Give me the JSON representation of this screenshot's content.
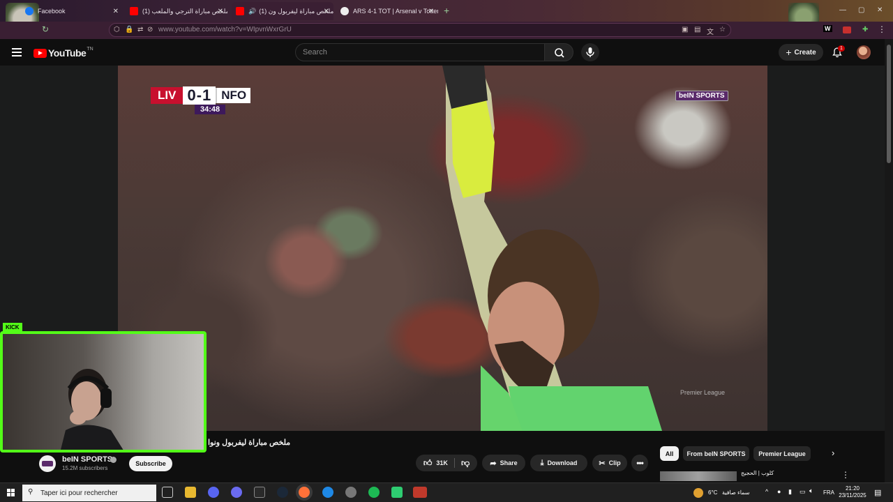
{
  "browser": {
    "tabs": [
      {
        "label": "Facebook",
        "active": false,
        "favicon_color": "#1877f2"
      },
      {
        "label": "(1) ملخص مباراة الترجي والملعب",
        "active": false,
        "favicon_color": "#ff0000"
      },
      {
        "label": "(1) ملخص مباراة ليفربول ون",
        "active": true,
        "favicon_color": "#ff0000"
      },
      {
        "label": "ARS 4-1 TOT | Arsenal v Tottenh",
        "active": false,
        "favicon_color": "#ffffff"
      }
    ],
    "url": "www.youtube.com/watch?v=WIpvnWxrGrU"
  },
  "youtube": {
    "logo_text": "YouTube",
    "logo_region": "TN",
    "search_placeholder": "Search",
    "create_label": "Create",
    "notification_count": "1"
  },
  "video": {
    "scoreboard": {
      "home": "LIV",
      "score": "0-1",
      "away": "NFO",
      "time": "34:48"
    },
    "broadcaster_logo": "beIN SPORTS",
    "watermark": "Premier League",
    "title": "ملخص مباراة ليفربول ونوا"
  },
  "webcam": {
    "platform_tag": "KICK"
  },
  "channel": {
    "name": "beIN SPORTS",
    "subscribers": "15.2M subscribers",
    "subscribe_label": "Subscribe"
  },
  "actions": {
    "likes": "31K",
    "share": "Share",
    "download": "Download",
    "clip": "Clip"
  },
  "chips": [
    "All",
    "From beIN SPORTS",
    "Premier League"
  ],
  "recommendation": {
    "title": "كلوب | الحجيج"
  },
  "taskbar": {
    "search_placeholder": "Taper ici pour rechercher",
    "weather": "6°C",
    "weather_desc": "سماء صافية",
    "lang": "FRA",
    "time": "21:20",
    "date": "23/11/2025"
  },
  "colors": {
    "kick_green": "#53fc18",
    "yt_red": "#ff0000",
    "liv_red": "#c8102e",
    "pl_purple": "#3d195b"
  }
}
